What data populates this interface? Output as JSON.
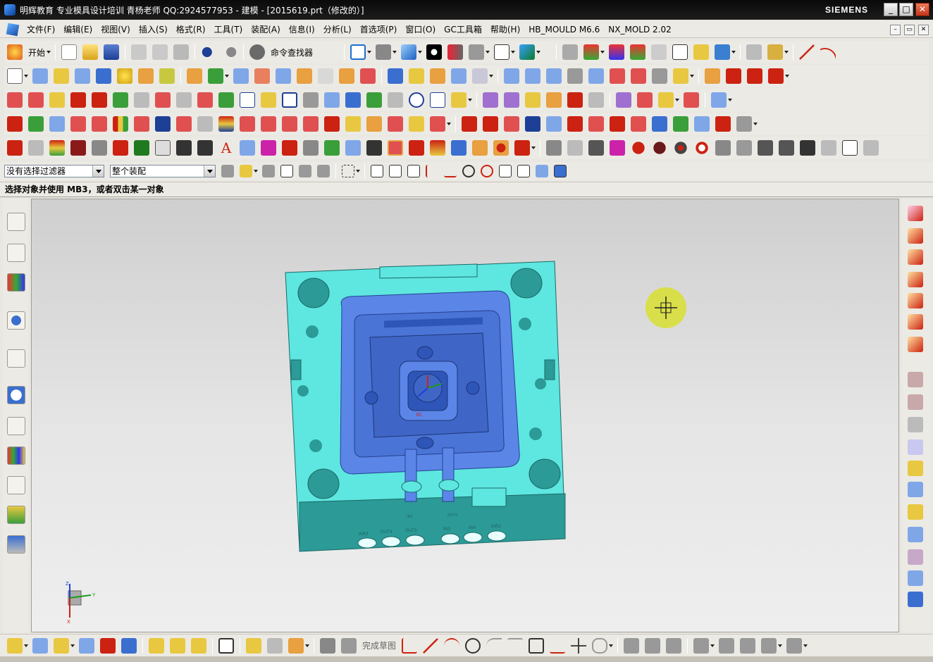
{
  "window": {
    "title": "明辉教育 专业模具设计培训 青杨老师  QQ:2924577953 - 建模 - [2015619.prt（修改的）]",
    "brand": "SIEMENS",
    "min": "_",
    "max": "□",
    "close": "✕"
  },
  "menu": {
    "items": [
      "文件(F)",
      "编辑(E)",
      "视图(V)",
      "插入(S)",
      "格式(R)",
      "工具(T)",
      "装配(A)",
      "信息(I)",
      "分析(L)",
      "首选项(P)",
      "窗口(O)",
      "GC工具箱",
      "帮助(H)",
      "HB_MOULD M6.6",
      "NX_MOLD 2.02"
    ],
    "mdi": [
      "–",
      "▭",
      "✕"
    ]
  },
  "toolbar": {
    "start_label": "开始",
    "command_finder_label": "命令查找器"
  },
  "selection": {
    "filter_value": "没有选择过滤器",
    "scope_value": "整个装配"
  },
  "cue": {
    "text": "选择对象并使用 MB3，或者双击某一对象"
  },
  "sketch": {
    "finish_label": "完成草图"
  },
  "model": {
    "engraved_labels": [
      "AIR3",
      "OUT4",
      "OUT3",
      "IN3",
      "IN4",
      "AIR2"
    ],
    "port_labels": [
      "IN3",
      "OUT3"
    ],
    "csys_label": "XC",
    "triad_labels": [
      "Z",
      "Y",
      "X"
    ]
  },
  "colors": {
    "plate": "#5ee6e0",
    "plate_dark": "#2c9a96",
    "insert": "#5b86e8",
    "insert_dark": "#2e55b8",
    "cursor_highlight": "#d8df3a",
    "titlebar": "#111111"
  }
}
